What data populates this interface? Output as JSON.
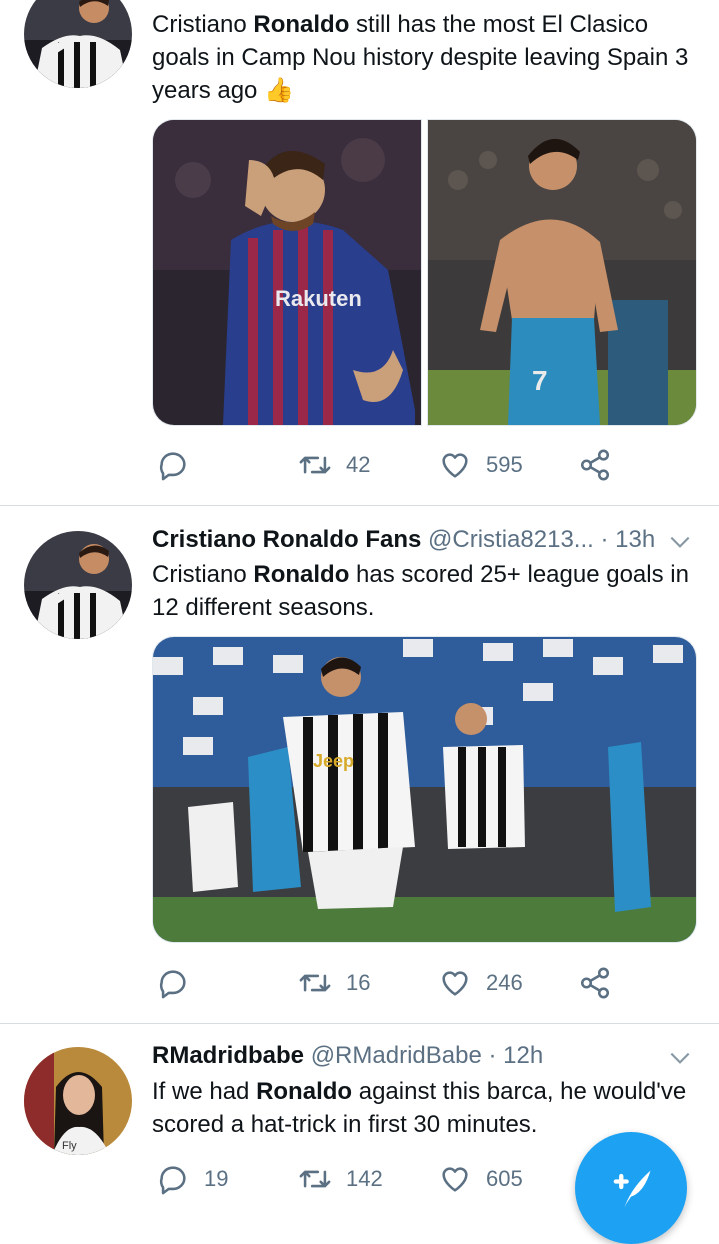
{
  "tweets": [
    {
      "header": {
        "name": "",
        "handle": "",
        "time": ""
      },
      "text": [
        {
          "t": "Cristiano ",
          "bold": false
        },
        {
          "t": "Ronaldo",
          "bold": true
        },
        {
          "t": " still has the most El Clasico goals in Camp Nou history despite leaving Spain 3 years ago ",
          "bold": false
        },
        {
          "t": "👍",
          "bold": false
        }
      ],
      "actions": {
        "reply": "",
        "retweet": "42",
        "like": "595"
      }
    },
    {
      "header": {
        "name": "Cristiano Ronaldo Fans",
        "handle": "@Cristia8213...",
        "time": "13h"
      },
      "text": [
        {
          "t": "Cristiano ",
          "bold": false
        },
        {
          "t": "Ronaldo",
          "bold": true
        },
        {
          "t": " has  scored 25+ league goals in 12 different seasons.",
          "bold": false
        }
      ],
      "actions": {
        "reply": "",
        "retweet": "16",
        "like": "246"
      }
    },
    {
      "header": {
        "name": "RMadridbabe",
        "handle": "@RMadridBabe",
        "time": "12h"
      },
      "text": [
        {
          "t": "If we had ",
          "bold": false
        },
        {
          "t": "Ronaldo",
          "bold": true
        },
        {
          "t": " against this barca, he would've scored a hat-trick in first 30 minutes.",
          "bold": false
        }
      ],
      "actions": {
        "reply": "19",
        "retweet": "142",
        "like": "605"
      }
    }
  ],
  "separator": "·",
  "colors": {
    "accent": "#1da1f2",
    "muted": "#5b7083",
    "text": "#0f1419"
  },
  "icons": {
    "reply": "reply-icon",
    "retweet": "retweet-icon",
    "like": "like-icon",
    "share": "share-icon",
    "compose": "compose-feather-icon",
    "caret": "chevron-down-icon"
  }
}
